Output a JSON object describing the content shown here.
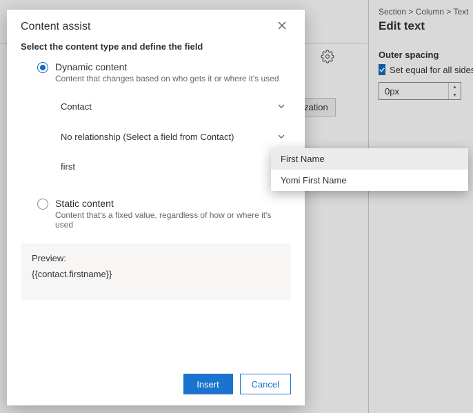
{
  "modal": {
    "title": "Content assist",
    "subtitle": "Select the content type and define the field",
    "dynamic": {
      "label": "Dynamic content",
      "desc": "Content that changes based on who gets it or where it's used",
      "entity": "Contact",
      "relationship": "No relationship (Select a field from Contact)",
      "search_value": "first"
    },
    "static": {
      "label": "Static content",
      "desc": "Content that's a fixed value, regardless of how or where it's used"
    },
    "preview": {
      "label": "Preview:",
      "value": "{{contact.firstname}}"
    },
    "buttons": {
      "insert": "Insert",
      "cancel": "Cancel"
    }
  },
  "flyout": {
    "items": [
      "First Name",
      "Yomi First Name"
    ]
  },
  "right_panel": {
    "breadcrumb": "Section  >  Column  >  Text",
    "title": "Edit text",
    "outer_spacing_label": "Outer spacing",
    "check_label": "Set equal for all sides",
    "spin_value": "0px"
  },
  "background": {
    "tab_fragment": "zation"
  }
}
